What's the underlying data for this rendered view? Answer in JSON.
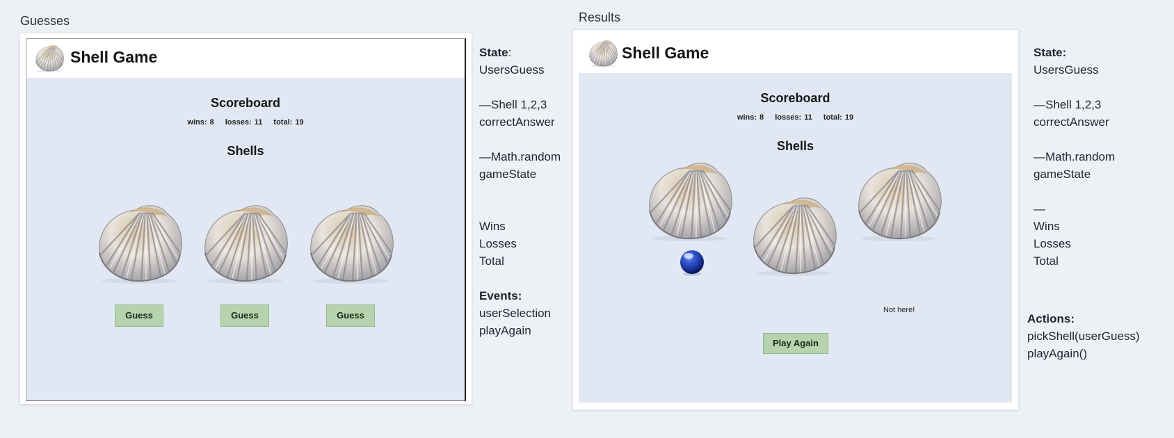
{
  "left_panel": {
    "frame_label": "Guesses",
    "app_title": "Shell Game",
    "scoreboard_title": "Scoreboard",
    "wins": "wins: 8",
    "losses": "losses: 11",
    "total": "total: 19",
    "shells_title": "Shells",
    "buttons": [
      "Guess",
      "Guess",
      "Guess"
    ]
  },
  "left_notes": {
    "state_heading": "State",
    "state_colon": ":",
    "state_value": "UsersGuess",
    "shell_line": "—Shell 1,2,3",
    "correct_answer": "correctAnswer",
    "math_random": "—Math.random",
    "game_state": "gameState",
    "wins": "Wins",
    "losses": "Losses",
    "total": "Total",
    "events_heading": "Events:",
    "event_1": "userSelection",
    "event_2": "playAgain"
  },
  "right_panel": {
    "frame_label": "Results",
    "app_title": "Shell Game",
    "scoreboard_title": "Scoreboard",
    "wins": "wins: 8",
    "losses": "losses: 11",
    "total": "total: 19",
    "shells_title": "Shells",
    "not_here_message": "Not here!",
    "play_again_label": "Play Again"
  },
  "right_notes": {
    "state_heading": "State:",
    "state_value": "UsersGuess",
    "shell_line": "—Shell 1,2,3",
    "correct_answer": "correctAnswer",
    "math_random": "—Math.random",
    "game_state": "gameState",
    "dash": "—",
    "wins": "Wins",
    "losses": "Losses",
    "total": "Total",
    "actions_heading": "Actions:",
    "action_1": "pickShell(userGuess)",
    "action_2": "playAgain()"
  },
  "icons": {
    "shell": "seashell-icon",
    "ball": "blue-ball-icon"
  },
  "colors": {
    "page_bg": "#edf1f6",
    "app_body_bg": "#e1e8f3",
    "button_bg": "#b5d3ad",
    "ball": "#1f3fb0"
  }
}
